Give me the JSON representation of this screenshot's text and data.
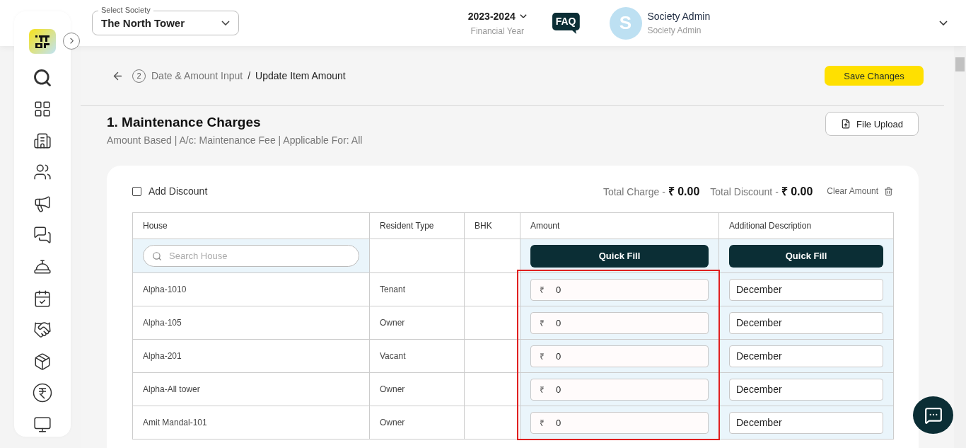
{
  "header": {
    "society_select": {
      "label": "Select Society",
      "value": "The North Tower"
    },
    "financial_year": {
      "value": "2023-2024",
      "caption": "Financial Year"
    },
    "faq": "FAQ",
    "user": {
      "initial": "S",
      "name": "Society Admin",
      "role": "Society Admin"
    }
  },
  "breadcrumb": {
    "step": "2",
    "parent": "Date & Amount Input",
    "separator": "/",
    "current": "Update Item Amount"
  },
  "save_button": "Save Changes",
  "section": {
    "title": "1. Maintenance Charges",
    "subtitle": "Amount Based | A/c: Maintenance Fee | Applicable For: All",
    "file_upload": "File Upload"
  },
  "discount": {
    "label": "Add Discount",
    "checked": false
  },
  "totals": [
    {
      "label": "Total Charge -",
      "value": "₹ 0.00"
    },
    {
      "label": "Total Discount -",
      "value": "₹ 0.00"
    }
  ],
  "clear_amount": "Clear Amount",
  "table": {
    "columns": [
      "House",
      "Resident Type",
      "BHK",
      "Amount",
      "Additional Description"
    ],
    "search": {
      "placeholder": "Search House"
    },
    "quick_fill": [
      "Quick Fill",
      "Quick Fill"
    ],
    "rows": [
      {
        "house": "Alpha-1010",
        "resident_type": "Tenant",
        "currency": "₹",
        "amount": "0",
        "description": "December"
      },
      {
        "house": "Alpha-105",
        "resident_type": "Owner",
        "currency": "₹",
        "amount": "0",
        "description": "December"
      },
      {
        "house": "Alpha-201",
        "resident_type": "Vacant",
        "currency": "₹",
        "amount": "0",
        "description": "December"
      },
      {
        "house": "Alpha-All tower",
        "resident_type": "Owner",
        "currency": "₹",
        "amount": "0",
        "description": "December"
      },
      {
        "house": "Amit Mandal-101",
        "resident_type": "Owner",
        "currency": "₹",
        "amount": "0",
        "description": "December"
      }
    ]
  },
  "annotation": {
    "kind": "highlight-box",
    "color": "#e02020"
  }
}
